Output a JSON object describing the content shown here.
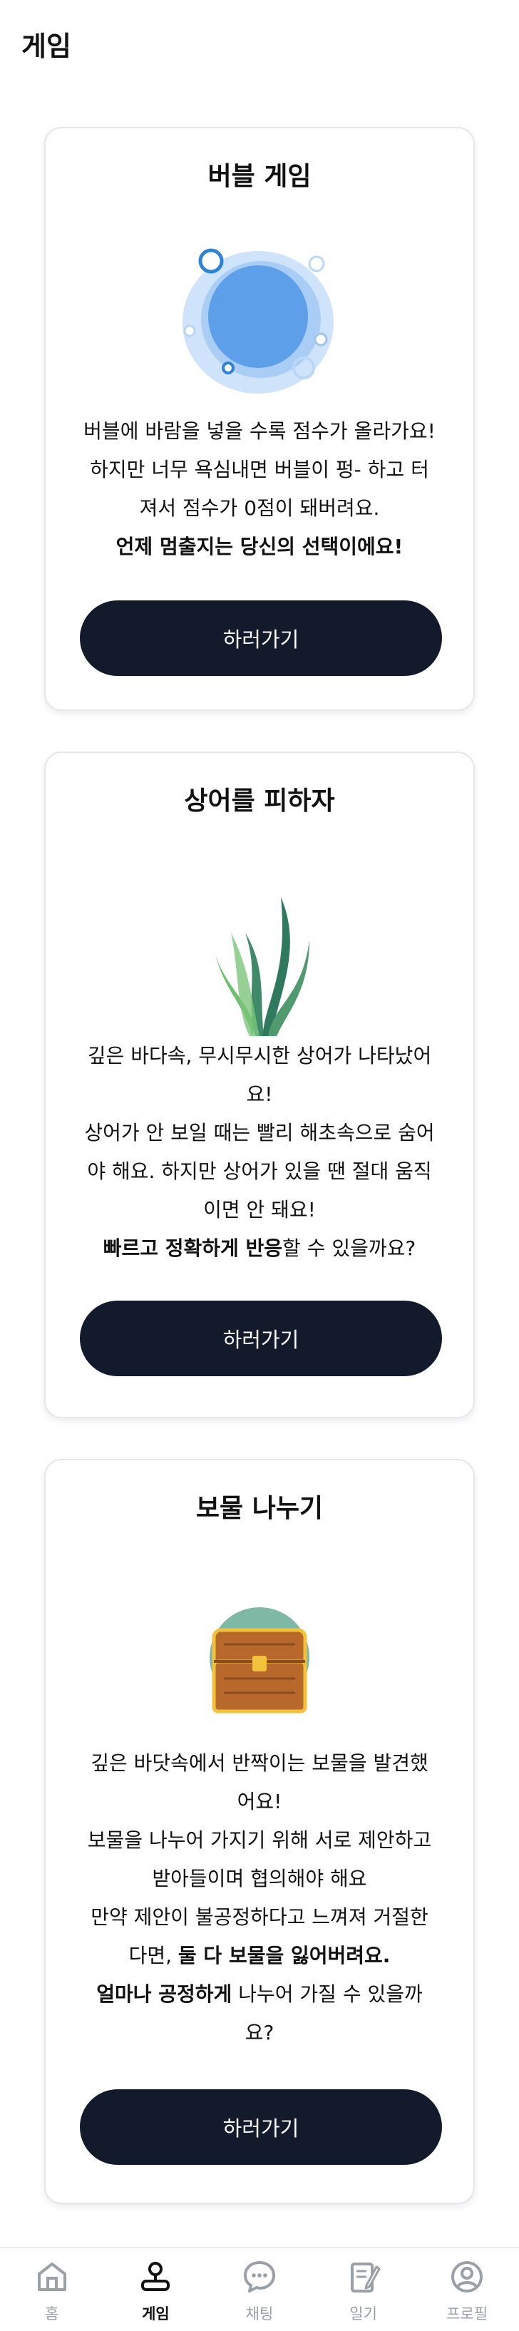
{
  "header": {
    "title": "게임"
  },
  "games": [
    {
      "title": "버블 게임",
      "image": "bubble-illustration",
      "desc_lines": [
        [
          {
            "t": "버블에 바람을 넣을 수록 점수가 올라가요!",
            "b": false
          }
        ],
        [
          {
            "t": "하지만 너무 욕심내면 버블이 펑- 하고 터",
            "b": false
          }
        ],
        [
          {
            "t": "져서 점수가 0점이 돼버려요.",
            "b": false
          }
        ],
        [
          {
            "t": "언제 멈출지는 당신의 선택이에요!",
            "b": true
          }
        ]
      ],
      "button": "하러가기"
    },
    {
      "title": "상어를 피하자",
      "image": "seaweed-illustration",
      "desc_lines": [
        [
          {
            "t": "깊은 바다속, 무시무시한 상어가 나타났어",
            "b": false
          }
        ],
        [
          {
            "t": "요!",
            "b": false
          }
        ],
        [
          {
            "t": "상어가 안 보일 때는 빨리 해초속으로 숨어",
            "b": false
          }
        ],
        [
          {
            "t": "야 해요. 하지만 상어가 있을 땐 절대 움직",
            "b": false
          }
        ],
        [
          {
            "t": "이면 안 돼요!",
            "b": false
          }
        ],
        [
          {
            "t": "빠르고 정확하게 반응",
            "b": true
          },
          {
            "t": "할 수 있을까요?",
            "b": false
          }
        ]
      ],
      "button": "하러가기"
    },
    {
      "title": "보물 나누기",
      "image": "treasure-chest-illustration",
      "desc_lines": [
        [
          {
            "t": "깊은 바닷속에서 반짝이는 보물을 발견했",
            "b": false
          }
        ],
        [
          {
            "t": "어요!",
            "b": false
          }
        ],
        [
          {
            "t": "보물을 나누어 가지기 위해 서로 제안하고",
            "b": false
          }
        ],
        [
          {
            "t": "받아들이며 협의해야 해요",
            "b": false
          }
        ],
        [
          {
            "t": "만약 제안이 불공정하다고 느껴져 거절한",
            "b": false
          }
        ],
        [
          {
            "t": "다면, ",
            "b": false
          },
          {
            "t": "둘 다 보물을 잃어버려요.",
            "b": true
          }
        ],
        [
          {
            "t": "얼마나 공정하게",
            "b": true
          },
          {
            "t": " 나누어 가질 수 있을까",
            "b": false
          }
        ],
        [
          {
            "t": "요?",
            "b": false
          }
        ]
      ],
      "button": "하러가기"
    }
  ],
  "nav": {
    "active": "게임",
    "items": [
      {
        "label": "홈",
        "icon": "home-icon"
      },
      {
        "label": "게임",
        "icon": "game-user-icon"
      },
      {
        "label": "채팅",
        "icon": "chat-icon"
      },
      {
        "label": "일기",
        "icon": "diary-icon"
      },
      {
        "label": "프로필",
        "icon": "profile-icon"
      }
    ]
  },
  "colors": {
    "button_bg": "#131a2c",
    "nav_active": "#111111",
    "nav_inactive": "#9aa0a8",
    "bubble": "#5d9fe8",
    "seaweed": "#3f8a6a",
    "chest": "#b8682a"
  }
}
